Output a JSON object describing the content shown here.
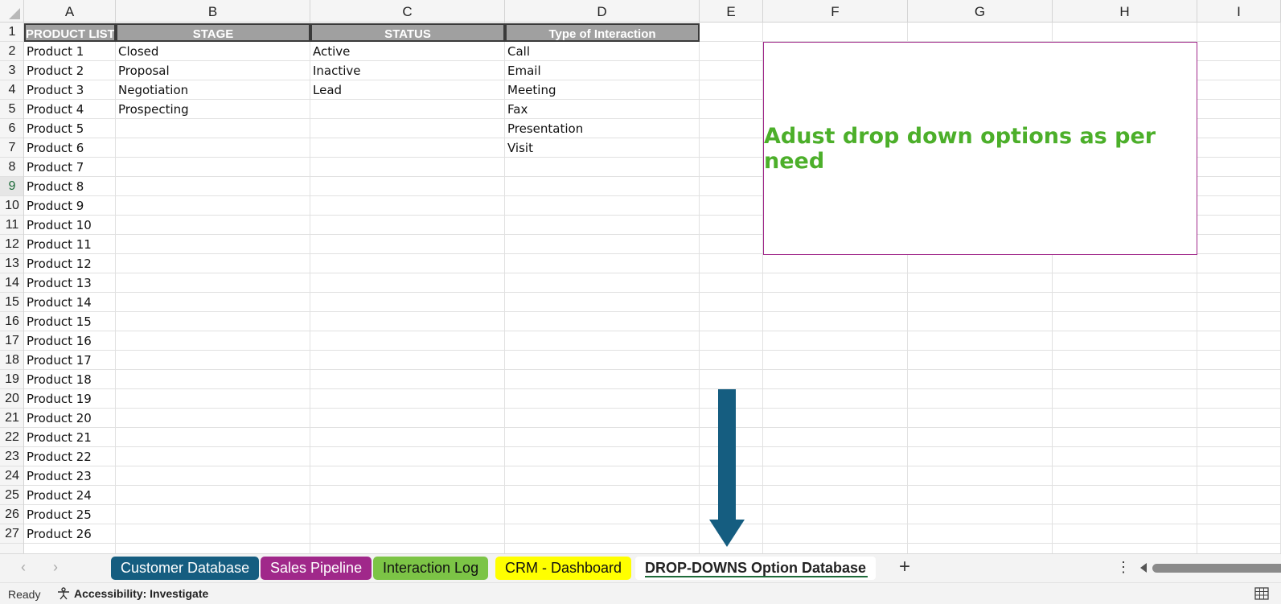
{
  "columns": [
    "A",
    "B",
    "C",
    "D",
    "E",
    "F",
    "G",
    "H",
    "I"
  ],
  "rows": [
    "1",
    "2",
    "3",
    "4",
    "5",
    "6",
    "7",
    "8",
    "9",
    "10",
    "11",
    "12",
    "13",
    "14",
    "15",
    "16",
    "17",
    "18",
    "19",
    "20",
    "21",
    "22",
    "23",
    "24",
    "25",
    "26",
    "27"
  ],
  "headers": {
    "product_list": "PRODUCT LIST",
    "stage": "STAGE",
    "status": "STATUS",
    "type_of_interaction": "Type of Interaction"
  },
  "products": [
    "Product 1",
    "Product 2",
    "Product 3",
    "Product 4",
    "Product 5",
    "Product 6",
    "Product 7",
    "Product 8",
    "Product 9",
    "Product 10",
    "Product 11",
    "Product 12",
    "Product 13",
    "Product 14",
    "Product 15",
    "Product 16",
    "Product 17",
    "Product 18",
    "Product 19",
    "Product 20",
    "Product 21",
    "Product 22",
    "Product 23",
    "Product 24",
    "Product 25",
    "Product 26"
  ],
  "stages": [
    "Closed",
    "Proposal",
    "Negotiation",
    "Prospecting"
  ],
  "statuses": [
    "Active",
    "Inactive",
    "Lead"
  ],
  "interactions": [
    "Call",
    "Email",
    "Meeting",
    "Fax",
    "Presentation",
    "Visit"
  ],
  "note": {
    "text": "Adust drop down options as per need",
    "text_color": "#4caf2a",
    "border_color": "#a0288a"
  },
  "arrow": {
    "color": "#155d80",
    "icon": "down-arrow-icon"
  },
  "sheet_tabs": [
    {
      "label": "Customer Database",
      "bg": "#155d80",
      "fg": "#ffffff"
    },
    {
      "label": "Sales Pipeline",
      "bg": "#a0288a",
      "fg": "#ffffff"
    },
    {
      "label": "Interaction Log",
      "bg": "#7cc446",
      "fg": "#111111"
    },
    {
      "label": "CRM - Dashboard",
      "bg": "#ffff00",
      "fg": "#111111"
    },
    {
      "label": "DROP-DOWNS Option Database",
      "active": true
    }
  ],
  "statusbar": {
    "ready": "Ready",
    "accessibility": "Accessibility: Investigate"
  },
  "active_row": "9"
}
